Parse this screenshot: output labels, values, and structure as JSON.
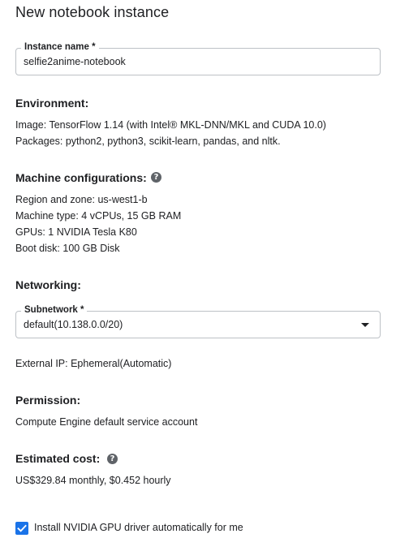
{
  "title": "New notebook instance",
  "instance_name": {
    "label": "Instance name *",
    "value": "selfie2anime-notebook"
  },
  "environment": {
    "heading": "Environment:",
    "image": "Image: TensorFlow 1.14 (with Intel® MKL-DNN/MKL and CUDA 10.0)",
    "packages": "Packages: python2, python3, scikit-learn, pandas, and nltk."
  },
  "machine": {
    "heading": "Machine configurations:",
    "help_icon": "help-icon",
    "region": "Region and zone: us-west1-b",
    "machine_type": "Machine type: 4 vCPUs, 15 GB RAM",
    "gpus": "GPUs: 1 NVIDIA Tesla K80",
    "boot_disk": "Boot disk: 100 GB Disk"
  },
  "networking": {
    "heading": "Networking:",
    "subnetwork_label": "Subnetwork *",
    "subnetwork_value": "default(10.138.0.0/20)",
    "external_ip": "External IP: Ephemeral(Automatic)"
  },
  "permission": {
    "heading": "Permission:",
    "value": "Compute Engine default service account"
  },
  "cost": {
    "heading": "Estimated cost:",
    "help_icon": "help-icon",
    "value": "US$329.84 monthly, $0.452 hourly"
  },
  "gpu_driver": {
    "checked": true,
    "label": "Install NVIDIA GPU driver automatically for me"
  },
  "colors": {
    "accent": "#1a73e8",
    "text": "#202124",
    "icon": "#5f6368",
    "border": "#bdc1c6"
  }
}
